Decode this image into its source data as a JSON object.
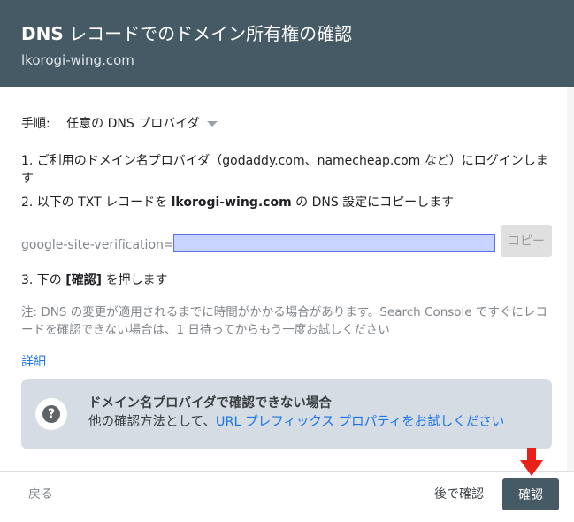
{
  "header": {
    "title_prefix": "DNS",
    "title_rest": " レコードでのドメイン所有権の確認",
    "subtitle": "lkorogi-wing.com"
  },
  "steps": {
    "label": "手順:",
    "provider_select": "任意の DNS プロバイダ",
    "step1": "1. ご利用のドメイン名プロバイダ（godaddy.com、namecheap.com など）にログインします",
    "step2_prefix": "2. 以下の TXT レコードを ",
    "step2_domain": "lkorogi-wing.com",
    "step2_suffix": " の DNS 設定にコピーします",
    "verification_label": "google-site-verification=",
    "copy_button": "コピー",
    "step3_prefix": "3. 下の ",
    "step3_bold": "[確認]",
    "step3_suffix": " を押します"
  },
  "note": "注: DNS の変更が適用されるまでに時間がかかる場合があります。Search Console ですぐにレコードを確認できない場合は、1 日待ってからもう一度お試しください",
  "details_link": "詳細",
  "info_box": {
    "title": "ドメイン名プロバイダで確認できない場合",
    "body_prefix": "他の確認方法として、",
    "body_link": "URL プレフィックス プロパティをお試しください",
    "icon": "help-icon"
  },
  "footer": {
    "back": "戻る",
    "later": "後で確認",
    "confirm": "確認"
  },
  "colors": {
    "header_bg": "#455a64",
    "link": "#1a73e8",
    "info_bg": "#d5dce4",
    "arrow": "#e8211a"
  }
}
